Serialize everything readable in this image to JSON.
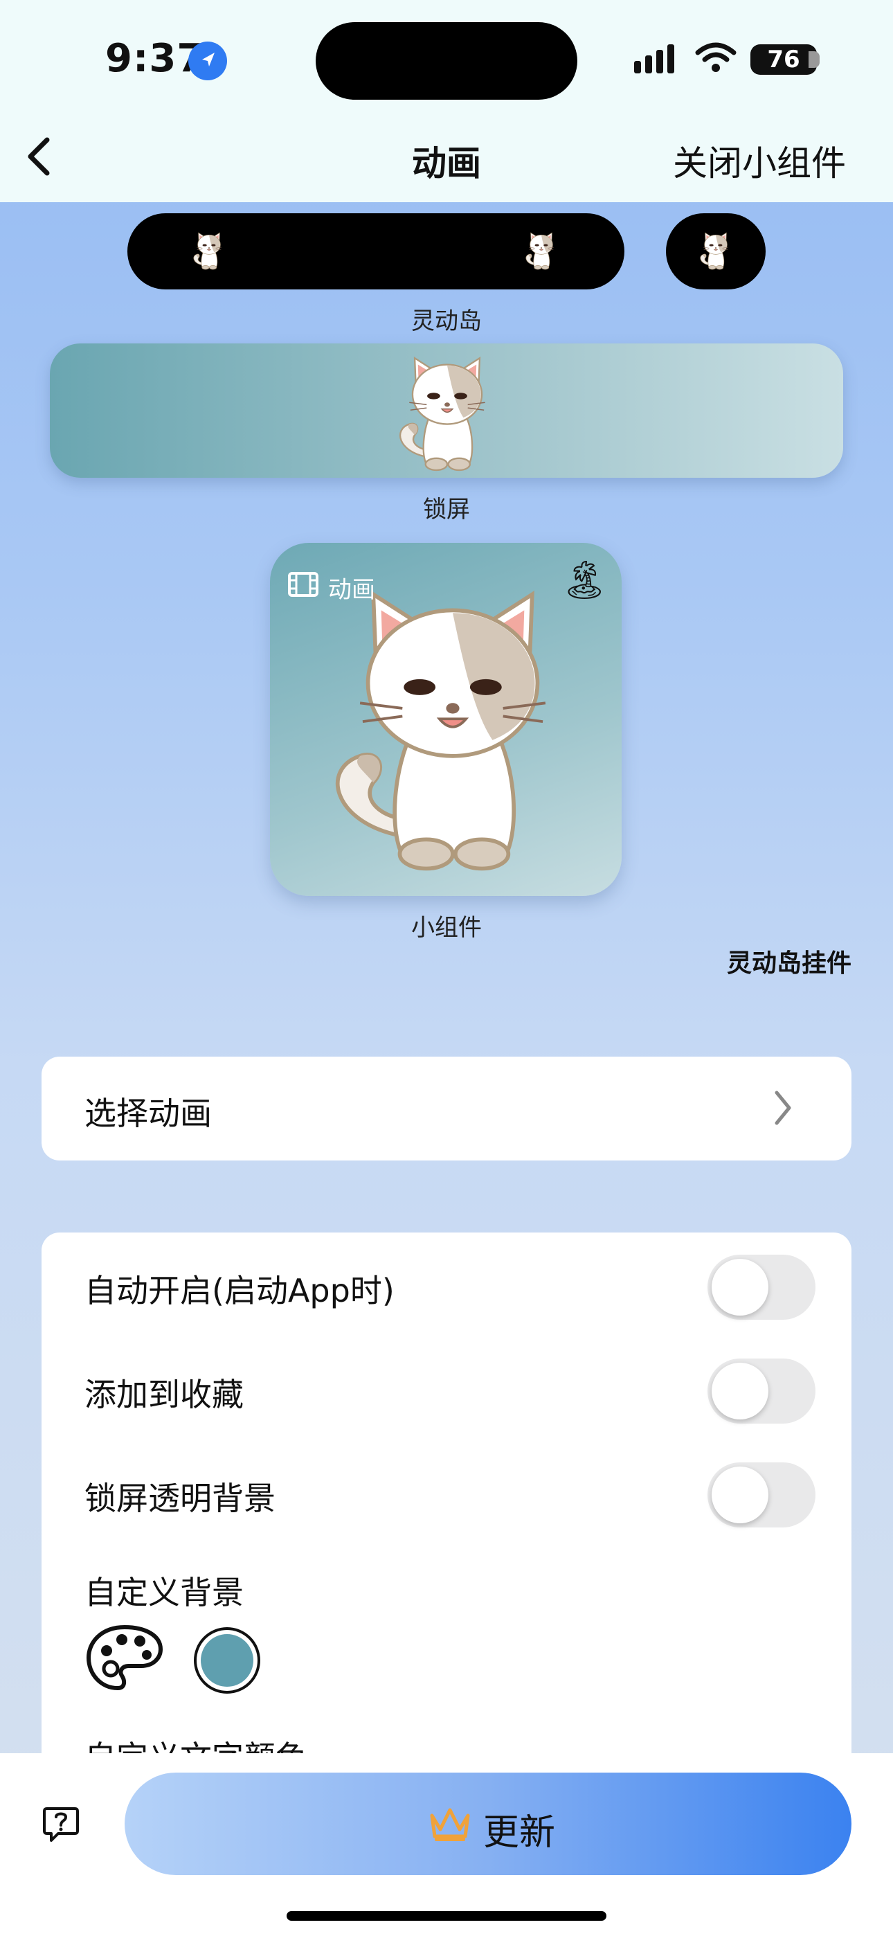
{
  "status_bar": {
    "time": "9:37",
    "battery": "76"
  },
  "nav": {
    "title": "动画",
    "right_action": "关闭小组件"
  },
  "previews": {
    "dynamic_island_caption": "灵动岛",
    "lock_screen_caption": "锁屏",
    "widget_label": "动画",
    "widget_caption": "小组件",
    "island_widget_label": "灵动岛挂件"
  },
  "select_row": {
    "label": "选择动画"
  },
  "settings": {
    "toggles": [
      {
        "label": "自动开启(启动App时)",
        "on": false
      },
      {
        "label": "添加到收藏",
        "on": false
      },
      {
        "label": "锁屏透明背景",
        "on": false
      }
    ],
    "custom_background_label": "自定义背景",
    "custom_text_color_label": "自定义文字颜色",
    "selected_color": "#5f9faf"
  },
  "bottom": {
    "update_label": "更新",
    "accent": "#3b82f0"
  }
}
